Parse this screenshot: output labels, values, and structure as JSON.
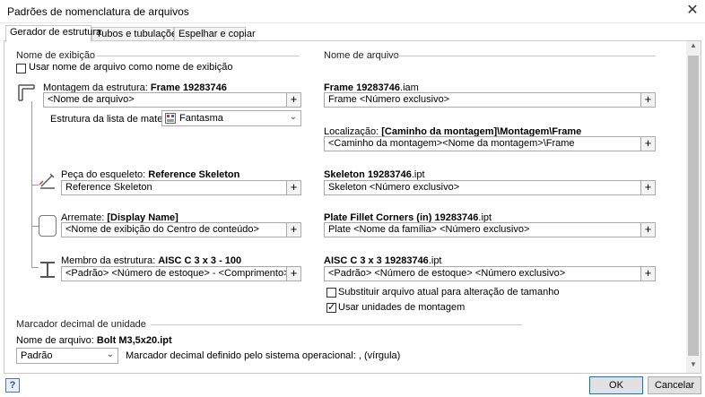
{
  "window": {
    "title": "Padrões de nomenclatura de arquivos"
  },
  "tabs": [
    "Gerador de estrutura",
    "Tubos e tubulações",
    "Espelhar e copiar"
  ],
  "display_name": {
    "heading": "Nome de exibição",
    "use_filename_label": "Usar nome de arquivo como nome de exibição",
    "assembly_label": "Montagem da estrutura: ",
    "assembly_value": "Frame 19283746",
    "assembly_field": "<Nome de arquivo>",
    "bom_label": "Estrutura da lista de materiais",
    "bom_value": "Fantasma",
    "skeleton_label": "Peça do esqueleto: ",
    "skeleton_value": "Reference Skeleton",
    "skeleton_field": "Reference Skeleton",
    "endtreat_label": "Arremate: ",
    "endtreat_value": "[Display Name]",
    "endtreat_field": "<Nome de exibição do Centro de conteúdo>",
    "member_label": "Membro da estrutura: ",
    "member_value": "AISC C 3 x 3 - 100",
    "member_field": "<Padrão> <Número de estoque> - <Comprimento>"
  },
  "file_name": {
    "heading": "Nome de arquivo",
    "frame_label": "Frame 19283746",
    "frame_ext": ".iam",
    "frame_field": "Frame <Número exclusivo>",
    "location_label": "Localização: ",
    "location_value": "[Caminho da montagem]\\Montagem\\Frame",
    "location_field": "<Caminho da montagem><Nome da montagem>\\Frame",
    "skeleton_label": "Skeleton 19283746",
    "skeleton_ext": ".ipt",
    "skeleton_field": "Skeleton <Número exclusivo>",
    "plate_label": "Plate Fillet Corners (in) 19283746",
    "plate_ext": ".ipt",
    "plate_field": "Plate <Nome da família> <Número exclusivo>",
    "member_label": "AISC C 3 x 3 19283746",
    "member_ext": ".ipt",
    "member_field": "<Padrão> <Número de estoque> <Número exclusivo>",
    "replace_label": "Substituir arquivo atual para alteração de tamanho",
    "assembly_units_label": "Usar unidades de montagem"
  },
  "decimal": {
    "heading": "Marcador decimal de unidade",
    "filename_label": "Nome de arquivo: ",
    "filename_value": "Bolt M3,5x20.ipt",
    "select_value": "Padrão",
    "os_text": "Marcador decimal definido pelo sistema operacional: , (vírgula)"
  },
  "buttons": {
    "ok": "OK",
    "cancel": "Cancelar",
    "plus": "+",
    "help": "?"
  }
}
